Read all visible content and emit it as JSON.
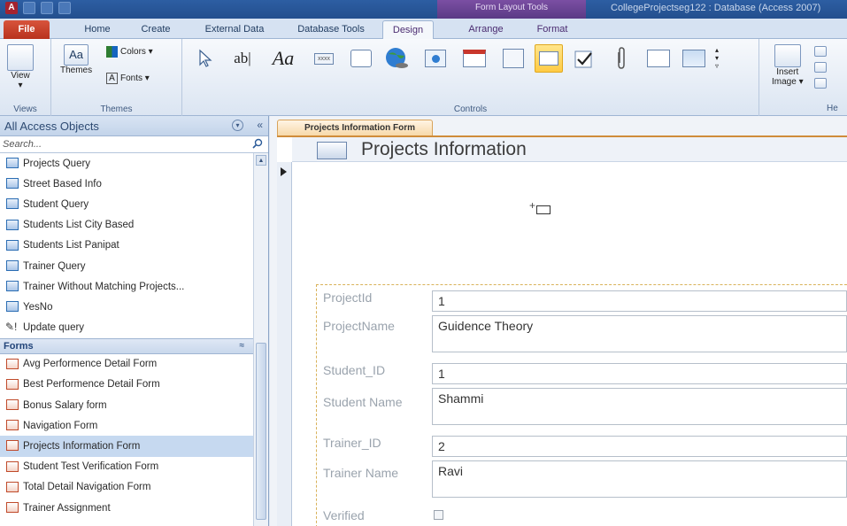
{
  "title_bar": {
    "context_group": "Form Layout Tools",
    "window_title": "CollegeProjectseg122 : Database (Access 2007)"
  },
  "tabs": [
    {
      "label": "File"
    },
    {
      "label": "Home"
    },
    {
      "label": "Create"
    },
    {
      "label": "External Data"
    },
    {
      "label": "Database Tools"
    },
    {
      "label": "Design"
    },
    {
      "label": "Arrange"
    },
    {
      "label": "Format"
    }
  ],
  "ribbon": {
    "views": {
      "button": "View",
      "group_label": "Views"
    },
    "themes": {
      "themes_button": "Themes",
      "colors": "Colors ▾",
      "fonts": "Fonts ▾",
      "group_label": "Themes"
    },
    "controls": {
      "group_label": "Controls",
      "textbox_glyph": "ab|",
      "label_glyph": "Aa",
      "button_glyph": "xxxx"
    },
    "insert_image": {
      "line1": "Insert",
      "line2": "Image ▾"
    },
    "header_group_label": "He"
  },
  "nav_pane": {
    "title": "All Access Objects",
    "search_placeholder": "Search...",
    "queries": [
      {
        "label": "Projects Query"
      },
      {
        "label": "Street Based Info"
      },
      {
        "label": "Student Query"
      },
      {
        "label": "Students List City Based"
      },
      {
        "label": "Students List Panipat"
      },
      {
        "label": "Trainer Query"
      },
      {
        "label": "Trainer Without Matching Projects..."
      },
      {
        "label": "YesNo"
      },
      {
        "label": "Update query"
      }
    ],
    "forms_category": "Forms",
    "forms": [
      {
        "label": "Avg Performence Detail Form"
      },
      {
        "label": "Best Performence Detail Form"
      },
      {
        "label": "Bonus Salary form"
      },
      {
        "label": "Navigation Form"
      },
      {
        "label": "Projects Information Form"
      },
      {
        "label": "Student Test Verification Form"
      },
      {
        "label": "Total Detail Navigation Form"
      },
      {
        "label": "Trainer Assignment"
      }
    ]
  },
  "document": {
    "tab_label": "Projects Information Form",
    "form_title": "Projects Information",
    "fields": [
      {
        "label": "ProjectId",
        "value": "1"
      },
      {
        "label": "ProjectName",
        "value": "Guidence Theory"
      },
      {
        "label": "Student_ID",
        "value": "1"
      },
      {
        "label": "Student Name",
        "value": "Shammi"
      },
      {
        "label": "Trainer_ID",
        "value": "2"
      },
      {
        "label": "Trainer Name",
        "value": "Ravi"
      },
      {
        "label": "Verified",
        "value": ""
      }
    ]
  },
  "colors": {
    "file_tab": "#b8321d",
    "selected_control": "#ffcb45",
    "layout_border": "#d9b25a"
  }
}
